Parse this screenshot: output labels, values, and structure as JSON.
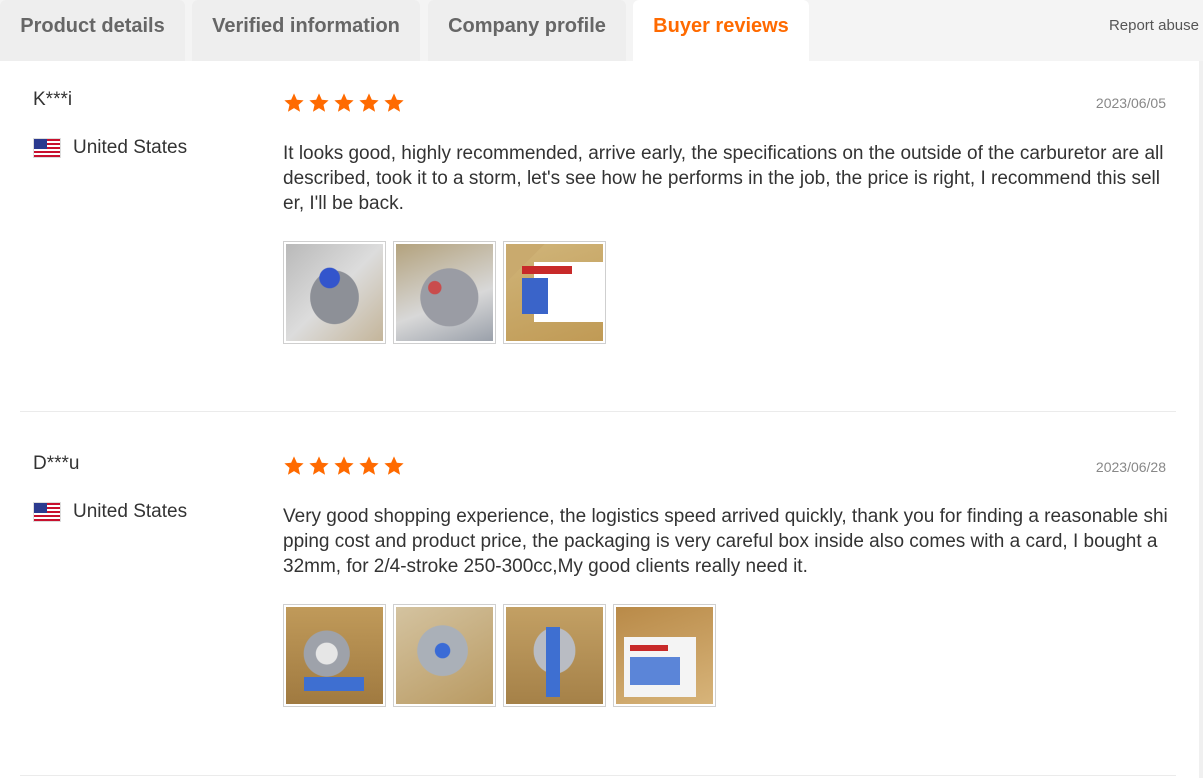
{
  "tabs": [
    {
      "label": "Product details",
      "active": false
    },
    {
      "label": "Verified information",
      "active": false
    },
    {
      "label": "Company profile",
      "active": false
    },
    {
      "label": "Buyer reviews",
      "active": true
    }
  ],
  "report_abuse": "Report abuse",
  "colors": {
    "accent": "#ff6a00",
    "star": "#ff6a00",
    "tab_bg": "#eeeeee"
  },
  "reviews": [
    {
      "name": "K***i",
      "country": "United States",
      "flag": "us-flag-icon",
      "rating": 5,
      "date": "2023/06/05",
      "text": "It looks good, highly recommended, arrive early, the specifications on the outside of the carburetor are all described, took it to a storm, let's see how he performs in the job, the price is right, I recommend this seller, I'll be back.",
      "photos": [
        "carburetor-in-hand-photo",
        "carburetor-in-box-photo",
        "product-box-photo"
      ]
    },
    {
      "name": "D***u",
      "country": "United States",
      "flag": "us-flag-icon",
      "rating": 5,
      "date": "2023/06/28",
      "text": "Very good shopping experience, the logistics speed arrived quickly, thank you for finding a reasonable shipping cost and product price, the packaging is very careful box inside also comes with a card, I bought a 32mm, for 2/4-stroke 250-300cc,My good clients really need it.",
      "photos": [
        "carburetor-front-photo",
        "carburetor-side-photo",
        "carburetor-top-photo",
        "product-box-open-photo"
      ]
    }
  ]
}
